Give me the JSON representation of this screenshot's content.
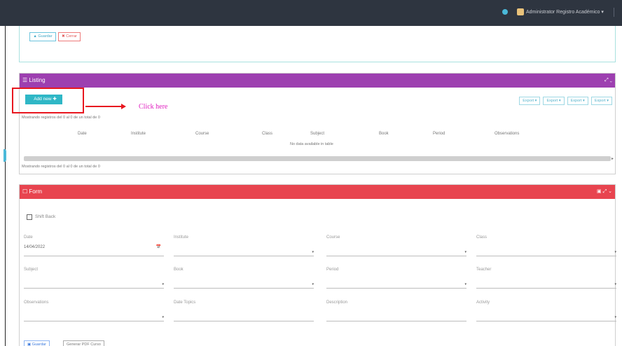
{
  "navbar": {
    "user_label": "Administrator Registro Académico ▾"
  },
  "top_panel": {
    "btn_blue": "▲ Guardar",
    "btn_red": "✖ Cerrar"
  },
  "listing": {
    "title": "☰ Listing",
    "tools": "⤢ ⌄",
    "add_button": "Add new ✚",
    "annotation": "Click here",
    "export_buttons": [
      "Export ▾",
      "Export ▾",
      "Export ▾",
      "Export ▾"
    ],
    "entries_top": "Mostrando registros del 0 al 0 de un total de 0",
    "entries_bottom": "Mostrando registros del 0 al 0 de un total de 0",
    "columns": [
      "Date",
      "Institute",
      "Course",
      "Class",
      "Subject",
      "Book",
      "Period",
      "Observations"
    ],
    "empty_message": "No data available in table",
    "scroll_arrow": "▸"
  },
  "form": {
    "title": "☐ Form",
    "tools": "▣ ⤢ ⌄",
    "checkbox_label": "Shift Back",
    "fields": [
      {
        "label": "Date",
        "value": "14/04/2022",
        "icon": "📅"
      },
      {
        "label": "Institute",
        "value": "",
        "icon": "▾"
      },
      {
        "label": "Course",
        "value": "",
        "icon": "▾"
      },
      {
        "label": "Class",
        "value": "",
        "icon": "▾"
      },
      {
        "label": "Subject",
        "value": "",
        "icon": "▾"
      },
      {
        "label": "Book",
        "value": "",
        "icon": "▾"
      },
      {
        "label": "Period",
        "value": "",
        "icon": "▾"
      },
      {
        "label": "Teacher",
        "value": "",
        "icon": "▾"
      },
      {
        "label": "Observations",
        "value": "",
        "icon": "▾"
      },
      {
        "label": "Date Topics",
        "value": "",
        "icon": ""
      },
      {
        "label": "Description",
        "value": "",
        "icon": ""
      },
      {
        "label": "Activity",
        "value": "",
        "icon": "▾"
      }
    ],
    "save_button": "▣ Guardar",
    "generate_button": "Generar PDF Curso"
  }
}
